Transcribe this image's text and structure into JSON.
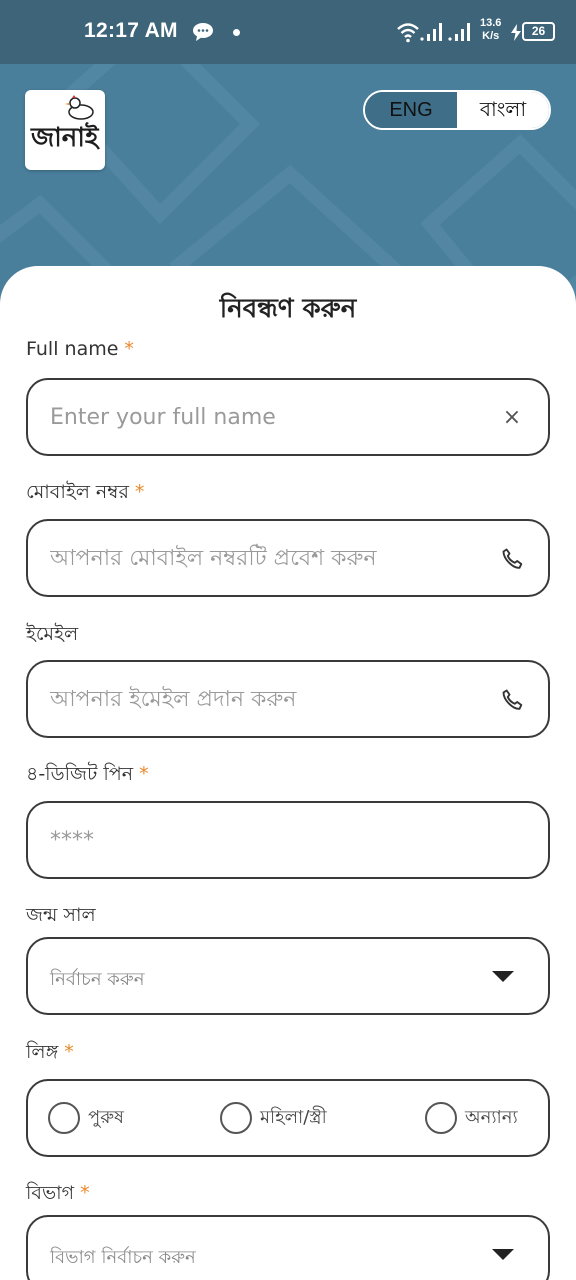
{
  "status_bar": {
    "time": "12:17 AM",
    "net_speed_value": "13.6",
    "net_speed_unit": "K/s",
    "battery": "26",
    "icons": [
      "chat-bubble-icon",
      "dot-icon",
      "wifi-icon",
      "signal-icon",
      "signal-icon",
      "charging-icon",
      "battery-icon"
    ]
  },
  "header": {
    "logo_text": "জানাই",
    "language_toggle": {
      "english": "ENG",
      "bangla": "বাংলা",
      "selected": "বাংলা"
    }
  },
  "form": {
    "title": "নিবন্ধণ করুন",
    "required_mark": "*",
    "full_name": {
      "label": "Full name",
      "placeholder": "Enter your full name",
      "clear_icon": "×"
    },
    "mobile": {
      "label": "মোবাইল নম্বর",
      "placeholder": "আপনার মোবাইল নম্বরটি প্রবেশ করুন",
      "icon": "phone-icon"
    },
    "email": {
      "label": "ইমেইল",
      "placeholder": "আপনার ইমেইল প্রদান করুন",
      "icon": "phone-icon"
    },
    "pin": {
      "label": "৪-ডিজিট পিন",
      "placeholder": "****"
    },
    "birth_year": {
      "label": "জন্ম সাল",
      "placeholder": "নির্বাচন করুন",
      "icon": "caret-down-icon"
    },
    "gender": {
      "label": "লিঙ্গ",
      "options": [
        "পুরুষ",
        "মহিলা/স্ত্রী",
        "অন্যান্য"
      ]
    },
    "division": {
      "label": "বিভাগ",
      "placeholder": "বিভাগ নির্বাচন করুন",
      "icon": "caret-down-icon"
    }
  },
  "colors": {
    "status_bar": "#3d6479",
    "header": "#4a7f9c",
    "required": "#e8892c",
    "border": "#3a3a3a"
  }
}
